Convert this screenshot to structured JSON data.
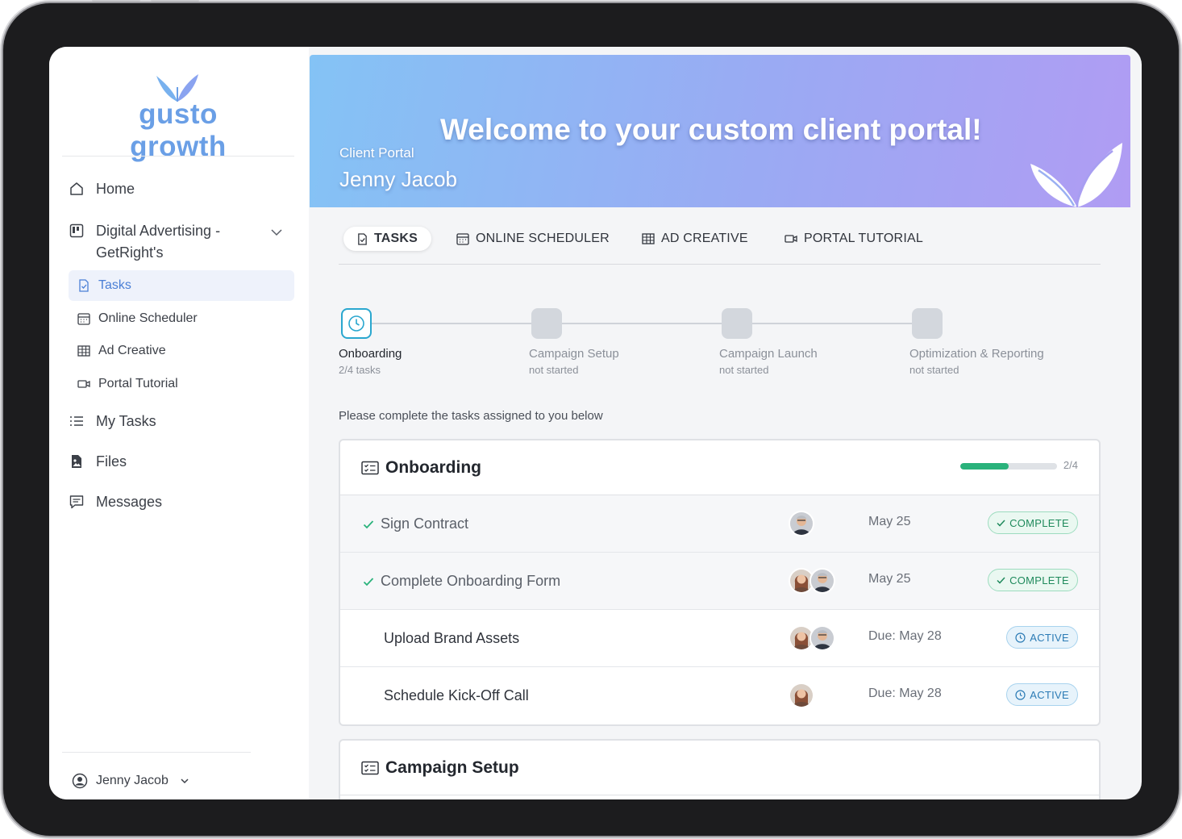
{
  "brand": {
    "logo_text": "gusto growth",
    "accent": "#6a9fe6"
  },
  "sidebar": {
    "items": [
      {
        "label": "Home",
        "icon": "home-icon"
      },
      {
        "label": "Digital Advertising - GetRight's",
        "line1": "Digital Advertising -",
        "line2": "GetRight's",
        "icon": "board-icon",
        "expanded": true
      },
      {
        "label": "My Tasks",
        "icon": "list-icon"
      },
      {
        "label": "Files",
        "icon": "file-image-icon"
      },
      {
        "label": "Messages",
        "icon": "message-icon"
      }
    ],
    "subitems": [
      {
        "label": "Tasks",
        "icon": "task-doc-icon",
        "active": true
      },
      {
        "label": "Online Scheduler",
        "icon": "calendar-icon"
      },
      {
        "label": "Ad Creative",
        "icon": "table-icon"
      },
      {
        "label": "Portal Tutorial",
        "icon": "video-icon"
      }
    ],
    "user": {
      "name": "Jenny Jacob",
      "icon": "user-circle-icon"
    }
  },
  "banner": {
    "title": "Welcome to your custom client portal!",
    "subtitle": "Client Portal",
    "client_name": "Jenny Jacob",
    "gradient": [
      "#84c3f5",
      "#b09cf3"
    ]
  },
  "tabs": [
    {
      "label": "TASKS",
      "icon": "task-doc-icon",
      "active": true
    },
    {
      "label": "ONLINE SCHEDULER",
      "icon": "calendar-icon"
    },
    {
      "label": "AD CREATIVE",
      "icon": "table-icon"
    },
    {
      "label": "PORTAL TUTORIAL",
      "icon": "video-icon"
    }
  ],
  "stages": [
    {
      "name": "Onboarding",
      "status": "2/4 tasks",
      "current": true
    },
    {
      "name": "Campaign Setup",
      "status": "not started"
    },
    {
      "name": "Campaign Launch",
      "status": "not started"
    },
    {
      "name": "Optimization & Reporting",
      "status": "not started"
    }
  ],
  "instructions": "Please complete the tasks assigned to you below",
  "sections": [
    {
      "title": "Onboarding",
      "progress_label": "2/4",
      "progress": 0.5,
      "tasks": [
        {
          "name": "Sign Contract",
          "date": "May 25",
          "status": "COMPLETE",
          "done": true,
          "assignees": [
            "man-avatar"
          ]
        },
        {
          "name": "Complete Onboarding Form",
          "date": "May 25",
          "status": "COMPLETE",
          "done": true,
          "assignees": [
            "woman-avatar",
            "man-avatar"
          ]
        },
        {
          "name": "Upload Brand Assets",
          "date": "Due: May 28",
          "status": "ACTIVE",
          "done": false,
          "assignees": [
            "woman-avatar",
            "man-avatar"
          ]
        },
        {
          "name": "Schedule Kick-Off Call",
          "date": "Due: May 28",
          "status": "ACTIVE",
          "done": false,
          "assignees": [
            "woman-avatar"
          ]
        }
      ]
    },
    {
      "title": "Campaign Setup"
    }
  ],
  "colors": {
    "complete": "#1f8a5c",
    "active": "#2b7bb5",
    "progress": "#2ab27b",
    "current_step": "#2aa7cf"
  }
}
